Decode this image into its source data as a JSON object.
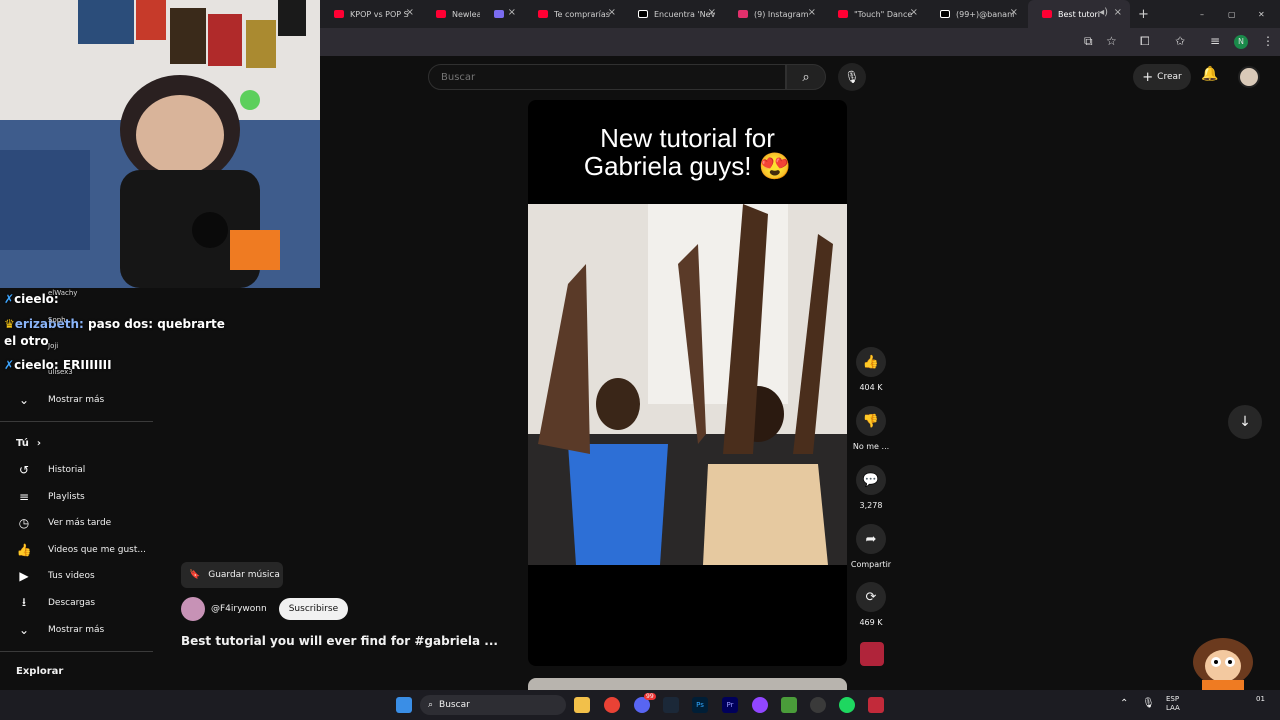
{
  "browser": {
    "tabs": [
      {
        "label": "KPOP vs POP S",
        "color": "#ff0033"
      },
      {
        "label": "Newleans",
        "color": "#ff0033"
      },
      {
        "label": "",
        "color": "#7b6cf0"
      },
      {
        "label": "Te comprarías",
        "color": "#ff0033"
      },
      {
        "label": "Encuentra 'Nev",
        "color": "#ffffff"
      },
      {
        "label": "(9) Instagram",
        "color": "#e1306c"
      },
      {
        "label": "\"Touch\" Dance",
        "color": "#ff0033"
      },
      {
        "label": "(99+)@banani",
        "color": "#ffffff"
      },
      {
        "label": "Best tutori",
        "color": "#ff0033"
      }
    ],
    "new_tab": "+",
    "profile_initial": "N"
  },
  "chat": {
    "lines": [
      {
        "user": "cieelo:",
        "msg": ""
      },
      {
        "user": "erizabeth:",
        "msg": "paso dos: quebrarte"
      },
      {
        "user": "",
        "msg": "el otro"
      },
      {
        "user": "cieelo:",
        "msg": "ERIIIIIII"
      }
    ],
    "overlay_names": [
      "elWachy",
      "Soph",
      "Joji",
      "ulisex3"
    ]
  },
  "sidebar": {
    "show_more_1": "Mostrar más",
    "you_header": "Tú",
    "you_items": [
      {
        "label": "Historial",
        "icon": "history-icon"
      },
      {
        "label": "Playlists",
        "icon": "playlist-icon"
      },
      {
        "label": "Ver más tarde",
        "icon": "clock-icon"
      },
      {
        "label": "Videos que me gust...",
        "icon": "thumbs-up-icon"
      },
      {
        "label": "Tus videos",
        "icon": "video-icon"
      },
      {
        "label": "Descargas",
        "icon": "download-icon"
      },
      {
        "label": "Mostrar más",
        "icon": "chevron-down-icon"
      }
    ],
    "explore_header": "Explorar"
  },
  "header": {
    "search_placeholder": "Buscar",
    "create_label": "Crear"
  },
  "short": {
    "caption_line1": "New tutorial for",
    "caption_line2": "Gabriela guys! 😍",
    "save_music": "Guardar música",
    "channel": "@F4irywonn",
    "subscribe": "Suscribirse",
    "title": "Best tutorial you will ever find for #gabriela ..."
  },
  "actions": {
    "likes": "404 K",
    "dislike": "No me ...",
    "comments": "3,278",
    "share": "Compartir",
    "remix": "469 K"
  },
  "taskbar": {
    "search": "Buscar",
    "lang": "ESP",
    "lang2": "LAA",
    "time": "01",
    "badge": "99"
  }
}
